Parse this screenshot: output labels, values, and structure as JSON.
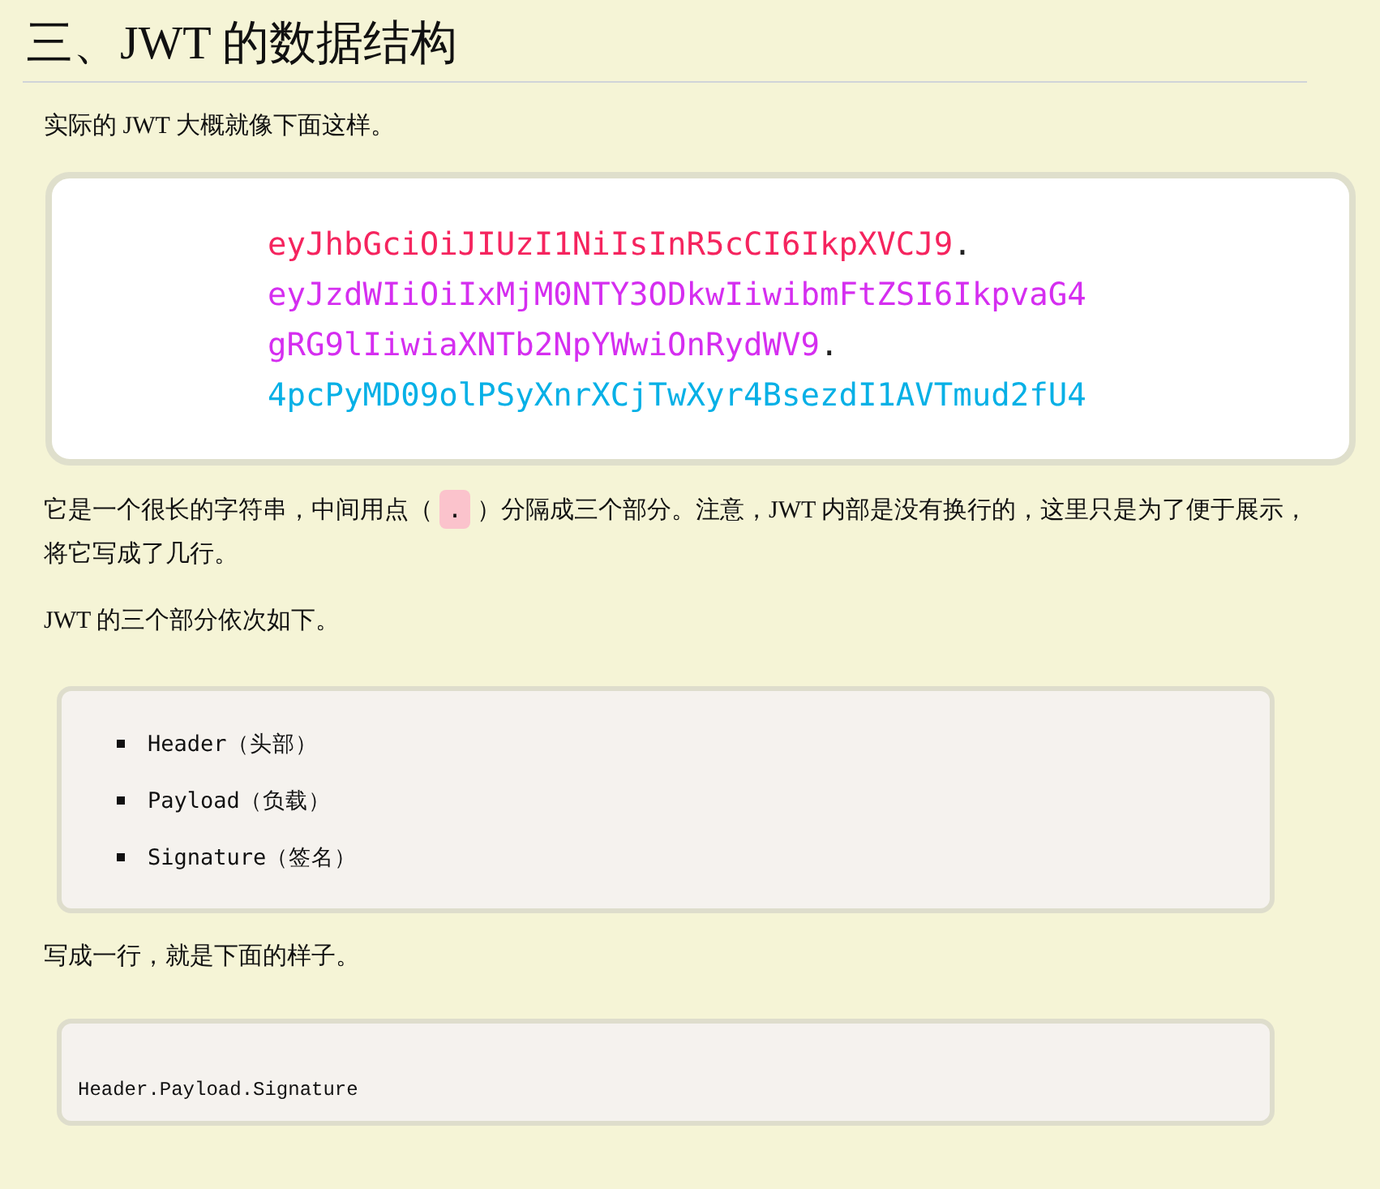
{
  "heading": "三、JWT 的数据结构",
  "intro": "实际的 JWT 大概就像下面这样。",
  "token_lines": [
    {
      "segments": [
        {
          "text": "eyJhbGciOiJIUzI1NiIsInR5cCI6IkpXVCJ9",
          "color": "#f5245e"
        },
        {
          "text": ".",
          "color": "#222222"
        }
      ]
    },
    {
      "segments": [
        {
          "text": "eyJzdWIiOiIxMjM0NTY3ODkwIiwibmFtZSI6IkpvaG4",
          "color": "#d52ef0"
        }
      ]
    },
    {
      "segments": [
        {
          "text": "gRG9lIiwiaXNTb2NpYWwiOnRydWV9",
          "color": "#d52ef0"
        },
        {
          "text": ".",
          "color": "#222222"
        }
      ]
    },
    {
      "segments": [
        {
          "text": "4pcPyMD09olPSyXnrXCjTwXyr4BsezdI1AVTmud2fU4",
          "color": "#06b0e6"
        }
      ]
    }
  ],
  "paragraph": [
    {
      "kind": "text",
      "text": "它是一个很长的字符串，中间用点（"
    },
    {
      "kind": "code",
      "text": "."
    },
    {
      "kind": "text",
      "text": "）分隔成三个部分。注意，JWT 内部是没有换行的，这里只是为了便于展示，将它写成了几行。"
    }
  ],
  "parts_intro": "JWT 的三个部分依次如下。",
  "parts": [
    "Header（头部）",
    "Payload（负载）",
    "Signature（签名）"
  ],
  "one_line_intro": "写成一行，就是下面的样子。",
  "one_line_code": "Header.Payload.Signature"
}
